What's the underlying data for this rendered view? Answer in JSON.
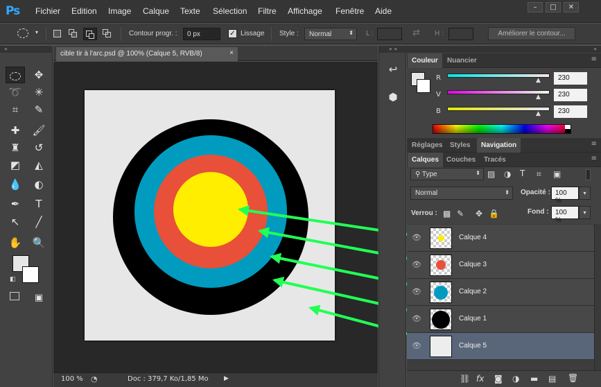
{
  "app": {
    "logo": "Ps",
    "menu": [
      "Fichier",
      "Edition",
      "Image",
      "Calque",
      "Texte",
      "Sélection",
      "Filtre",
      "Affichage",
      "Fenêtre",
      "Aide"
    ],
    "window_buttons": [
      "–",
      "□",
      "✕"
    ]
  },
  "options": {
    "contour_label": "Contour progr. :",
    "contour_value": "0 px",
    "lissage_label": "Lissage",
    "style_label": "Style :",
    "style_value": "Normal",
    "l_label": "L :",
    "h_label": "H :",
    "ameliorer_button": "Améliorer le contour..."
  },
  "document": {
    "tab_title": "cible tir à l'arc.psd @ 100% (Calque 5, RVB/8)",
    "close": "×",
    "zoom": "100 %",
    "doc_info": "Doc : 379,7 Ko/1,85 Mo"
  },
  "color_panel": {
    "tabs": [
      "Couleur",
      "Nuancier"
    ],
    "channels": [
      {
        "label": "R",
        "value": "230"
      },
      {
        "label": "V",
        "value": "230"
      },
      {
        "label": "B",
        "value": "230"
      }
    ]
  },
  "adjust_panel": {
    "tabs": [
      "Réglages",
      "Styles",
      "Navigation"
    ]
  },
  "layers_panel": {
    "tabs": [
      "Calques",
      "Couches",
      "Tracés"
    ],
    "filter_value": "Type",
    "blend_mode": "Normal",
    "opacity_label": "Opacité :",
    "opacity_value": "100 %",
    "lock_label": "Verrou :",
    "fill_label": "Fond :",
    "fill_value": "100 %",
    "layers": [
      {
        "name": "Calque 4"
      },
      {
        "name": "Calque 3"
      },
      {
        "name": "Calque 2"
      },
      {
        "name": "Calque 1"
      },
      {
        "name": "Calque 5"
      }
    ]
  },
  "colors": {
    "target_black": "#000000",
    "target_blue": "#009bbf",
    "target_red": "#e8503a",
    "target_yellow": "#ffee00",
    "arrow_green": "#22ff55",
    "canvas_bg": "#e7e7e7",
    "selected_layer": "#59667a"
  }
}
